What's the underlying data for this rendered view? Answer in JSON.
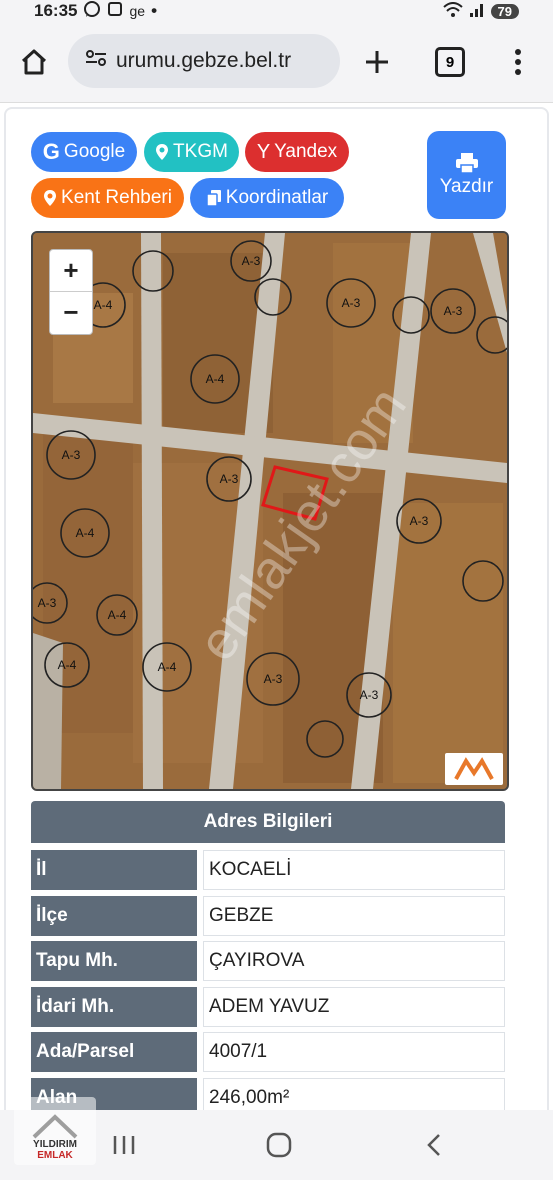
{
  "status": {
    "time": "16:35",
    "app": "ge",
    "battery": "79"
  },
  "browser": {
    "url": "urumu.gebze.bel.tr",
    "tabs": "9"
  },
  "buttons": {
    "google": "Google",
    "tkgm": "TKGM",
    "yandex": "Yandex",
    "kent": "Kent Rehberi",
    "koord": "Koordinatlar",
    "print": "Yazdır"
  },
  "map": {
    "zoom_in": "+",
    "zoom_out": "−",
    "watermark": "emlakjet.com",
    "zone_labels": [
      "A-4",
      "A-3",
      "A-3",
      "A-4",
      "A-3",
      "A-3",
      "A-4",
      "A-3",
      "A-4",
      "A-3",
      "A-3",
      "A-4",
      "A-3",
      "A-4",
      "A-3"
    ]
  },
  "address": {
    "title": "Adres Bilgileri",
    "rows": [
      {
        "key": "İl",
        "value": "KOCAELİ"
      },
      {
        "key": "İlçe",
        "value": "GEBZE"
      },
      {
        "key": "Tapu Mh.",
        "value": "ÇAYIROVA"
      },
      {
        "key": "İdari Mh.",
        "value": "ADEM YAVUZ"
      },
      {
        "key": "Ada/Parsel",
        "value": "4007/1"
      },
      {
        "key": "Alan",
        "value": "246,00m²"
      }
    ]
  },
  "overlay_logo": {
    "line1": "YILDIRIM",
    "line2": "EMLAK"
  },
  "colors": {
    "accent_blue": "#3b82f6",
    "table_header": "#5e6b79"
  }
}
